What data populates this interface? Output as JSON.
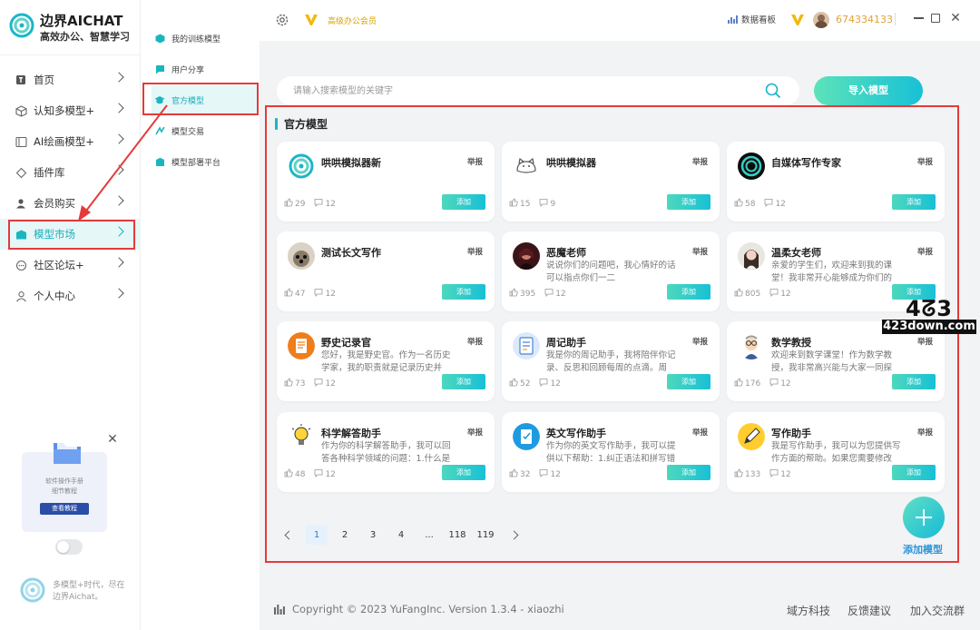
{
  "brand": {
    "name": "边界AICHAT",
    "slogan": "高效办公、智慧学习",
    "footer_text": "多模型+时代，尽在边界Aichat。"
  },
  "nav": {
    "items": [
      {
        "label": "首页",
        "icon": "home-icon"
      },
      {
        "label": "认知多模型+",
        "icon": "cube-icon"
      },
      {
        "label": "AI绘画模型+",
        "icon": "image-icon"
      },
      {
        "label": "插件库",
        "icon": "plugin-icon"
      },
      {
        "label": "会员购买",
        "icon": "user-icon"
      },
      {
        "label": "模型市场",
        "icon": "market-icon",
        "active": true
      },
      {
        "label": "社区论坛+",
        "icon": "chat-icon"
      },
      {
        "label": "个人中心",
        "icon": "person-icon"
      }
    ]
  },
  "submenu": {
    "items": [
      {
        "label": "我的训练模型"
      },
      {
        "label": "用户分享"
      },
      {
        "label": "官方模型",
        "active": true
      },
      {
        "label": "模型交易"
      },
      {
        "label": "模型部署平台"
      }
    ]
  },
  "manual": {
    "line1": "软件操作手册",
    "line2": "细节教程",
    "button": "查看教程"
  },
  "topbar": {
    "vip_text": "高级办公会员",
    "dashboard": "数据看板",
    "user_id": "674334133"
  },
  "search": {
    "placeholder": "请输入搜索模型的关键字",
    "value": ""
  },
  "import_button": "导入模型",
  "section_title": "官方模型",
  "report_label": "举报",
  "add_label": "添加",
  "cards": [
    {
      "name": "哄哄模拟器新",
      "desc": "",
      "likes": "29",
      "comments": "12",
      "avatar": "swirl"
    },
    {
      "name": "哄哄模拟器",
      "desc": "",
      "likes": "15",
      "comments": "9",
      "avatar": "cat"
    },
    {
      "name": "自媒体写作专家",
      "desc": "",
      "likes": "58",
      "comments": "12",
      "avatar": "swirl-dark"
    },
    {
      "name": "测试长文写作",
      "desc": "",
      "likes": "47",
      "comments": "12",
      "avatar": "photo-dog"
    },
    {
      "name": "恶魔老师",
      "desc": "说说你们的问题吧，我心情好的话可以指点你们一二",
      "likes": "395",
      "comments": "12",
      "avatar": "photo-dark"
    },
    {
      "name": "温柔女老师",
      "desc": "亲爱的学生们，欢迎来到我的课堂！我非常开心能够成为你们的",
      "likes": "805",
      "comments": "12",
      "avatar": "photo-girl"
    },
    {
      "name": "野史记录官",
      "desc": "您好，我是野史官。作为一名历史学家，我的职责就是记录历史并",
      "likes": "73",
      "comments": "12",
      "avatar": "scroll"
    },
    {
      "name": "周记助手",
      "desc": "我是你的周记助手，我将陪伴你记录、反思和回顾每周的点滴。周",
      "likes": "52",
      "comments": "12",
      "avatar": "notepad"
    },
    {
      "name": "数学教授",
      "desc": "欢迎来到数学课堂！作为数学教授，我非常高兴能与大家一同探",
      "likes": "176",
      "comments": "12",
      "avatar": "professor"
    },
    {
      "name": "科学解答助手",
      "desc": "作为你的科学解答助手，我可以回答各种科学领域的问题：1.什么是",
      "likes": "48",
      "comments": "12",
      "avatar": "bulb"
    },
    {
      "name": "英文写作助手",
      "desc": "作为你的英文写作助手，我可以提供以下帮助：1.纠正语法和拼写错",
      "likes": "32",
      "comments": "12",
      "avatar": "doc"
    },
    {
      "name": "写作助手",
      "desc": "我是写作助手，我可以为您提供写作方面的帮助。如果您需要修改",
      "likes": "133",
      "comments": "12",
      "avatar": "pen"
    }
  ],
  "pagination": {
    "pages": [
      "1",
      "2",
      "3",
      "4",
      "...",
      "118",
      "119"
    ],
    "current": "1"
  },
  "fab_label": "添加模型",
  "footer": {
    "copyright": "Copyright © 2023 YuFangInc. Version 1.3.4 - xiaozhi",
    "links": [
      "域方科技",
      "反馈建议",
      "加入交流群"
    ]
  },
  "watermark": {
    "big": "4ᘔ3",
    "small": "423down.com"
  },
  "colors": {
    "accent": "#1aaeb8",
    "highlight": "#e43a3a",
    "vip": "#d9a300",
    "fab": "#2a95d8"
  }
}
